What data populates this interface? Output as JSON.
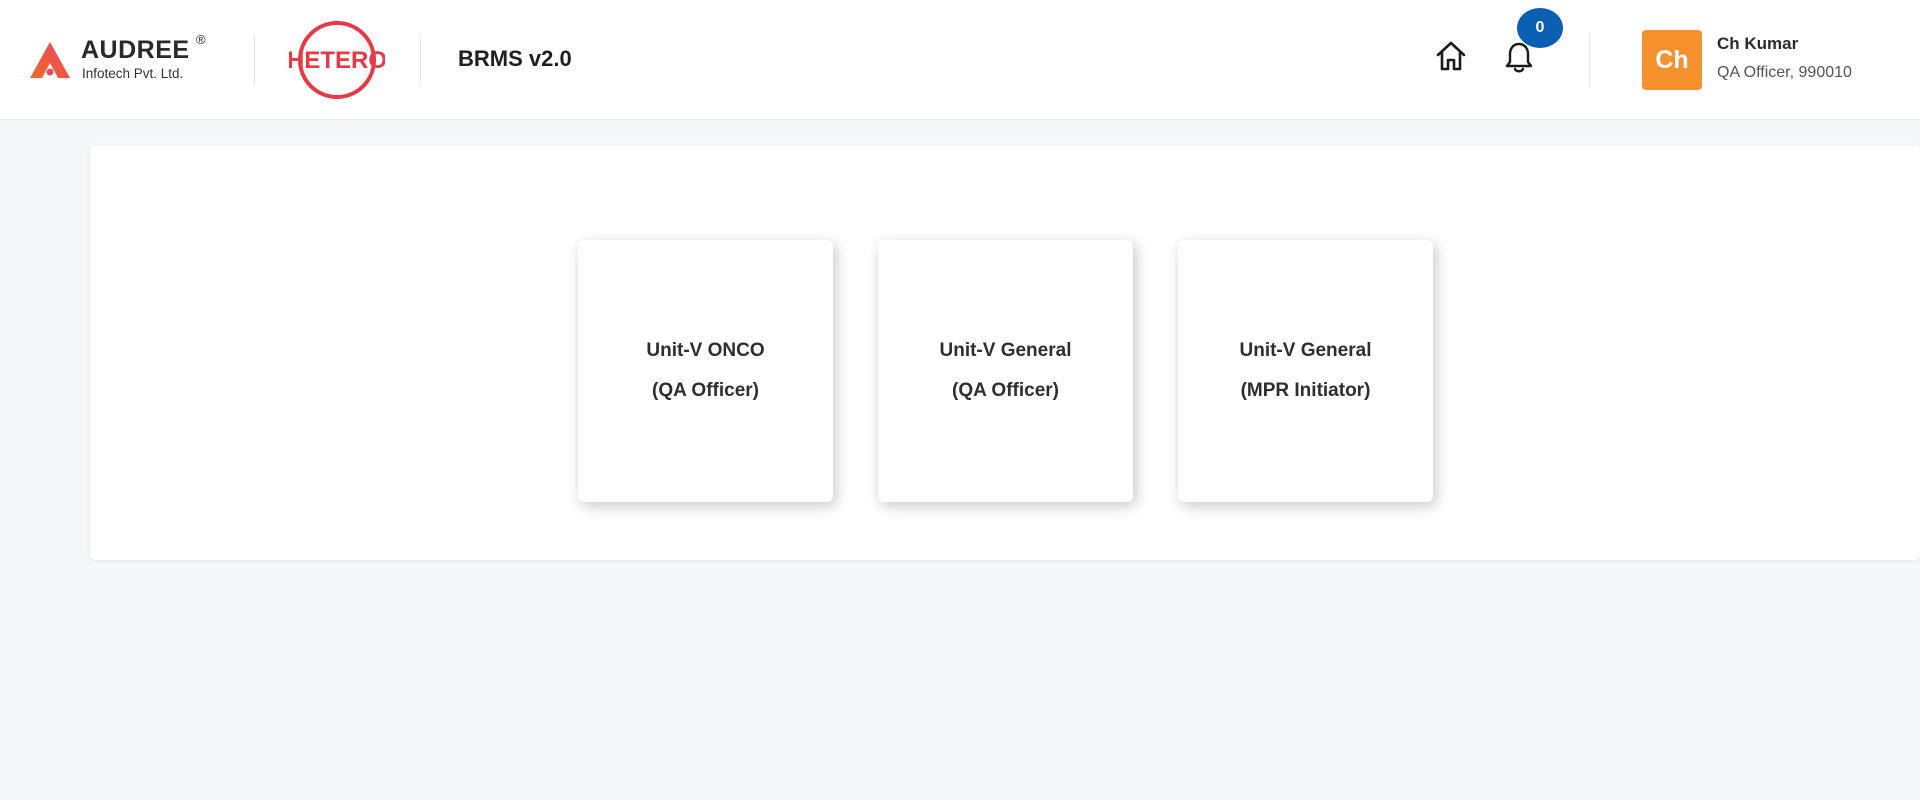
{
  "header": {
    "audree": {
      "brand": "AUDREE",
      "reg": "®",
      "subtitle": "Infotech Pvt. Ltd."
    },
    "hetero": {
      "brand": "HETERO"
    },
    "app_title": "BRMS v2.0",
    "notifications": {
      "count": "0"
    },
    "user": {
      "initials": "Ch",
      "name": "Ch Kumar",
      "role": "QA Officer, 990010"
    }
  },
  "cards": [
    {
      "line1": "Unit-V ONCO",
      "line2": "(QA Officer)"
    },
    {
      "line1": "Unit-V General",
      "line2": "(QA Officer)"
    },
    {
      "line1": "Unit-V General",
      "line2": "(MPR Initiator)"
    }
  ],
  "colors": {
    "accent_orange": "#f5922e",
    "badge_blue": "#0a5fb3",
    "hetero_red": "#e63a46"
  }
}
